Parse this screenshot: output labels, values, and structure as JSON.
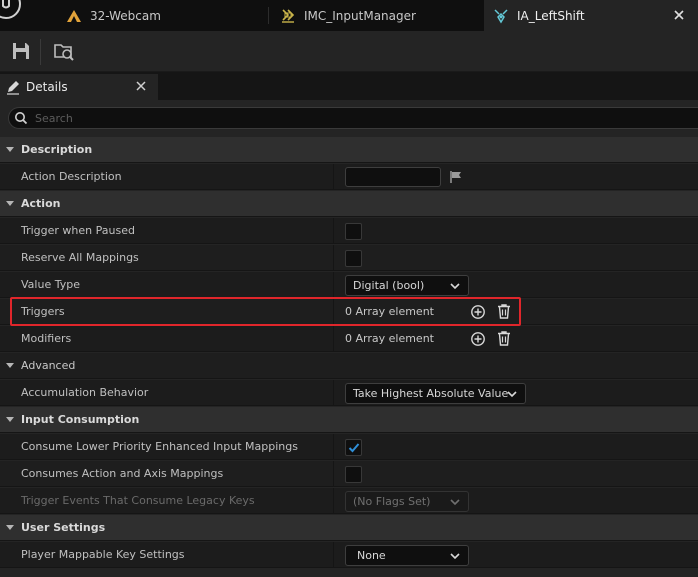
{
  "tabs": [
    {
      "label": "32-Webcam",
      "icon": "level-icon",
      "color": "#e2a33a"
    },
    {
      "label": "IMC_InputManager",
      "icon": "mapping-context-icon",
      "color": "#c9b44a"
    },
    {
      "label": "IA_LeftShift",
      "icon": "input-action-icon",
      "color": "#63c8d6",
      "active": true
    }
  ],
  "details": {
    "tab_label": "Details",
    "search_placeholder": "Search"
  },
  "sections": {
    "description": {
      "label": "Description",
      "action_description": {
        "label": "Action Description",
        "value": ""
      }
    },
    "action": {
      "label": "Action",
      "trigger_when_paused": {
        "label": "Trigger when Paused",
        "checked": false
      },
      "reserve_all_mappings": {
        "label": "Reserve All Mappings",
        "checked": false
      },
      "value_type": {
        "label": "Value Type",
        "value": "Digital (bool)"
      },
      "triggers": {
        "label": "Triggers",
        "value": "0 Array element"
      },
      "modifiers": {
        "label": "Modifiers",
        "value": "0 Array element"
      }
    },
    "advanced": {
      "label": "Advanced",
      "accumulation_behavior": {
        "label": "Accumulation Behavior",
        "value": "Take Highest Absolute Value"
      }
    },
    "input_consumption": {
      "label": "Input Consumption",
      "consume_lower_priority": {
        "label": "Consume Lower Priority Enhanced Input Mappings",
        "checked": true
      },
      "consumes_action_axis": {
        "label": "Consumes Action and Axis Mappings",
        "checked": false
      },
      "trigger_events_legacy": {
        "label": "Trigger Events That Consume Legacy Keys",
        "value": "(No Flags Set)",
        "disabled": true
      }
    },
    "user_settings": {
      "label": "User Settings",
      "player_mappable": {
        "label": "Player Mappable Key Settings",
        "value": "None"
      }
    }
  },
  "colors": {
    "highlight": "#e0262b",
    "check": "#2f8fd8"
  }
}
